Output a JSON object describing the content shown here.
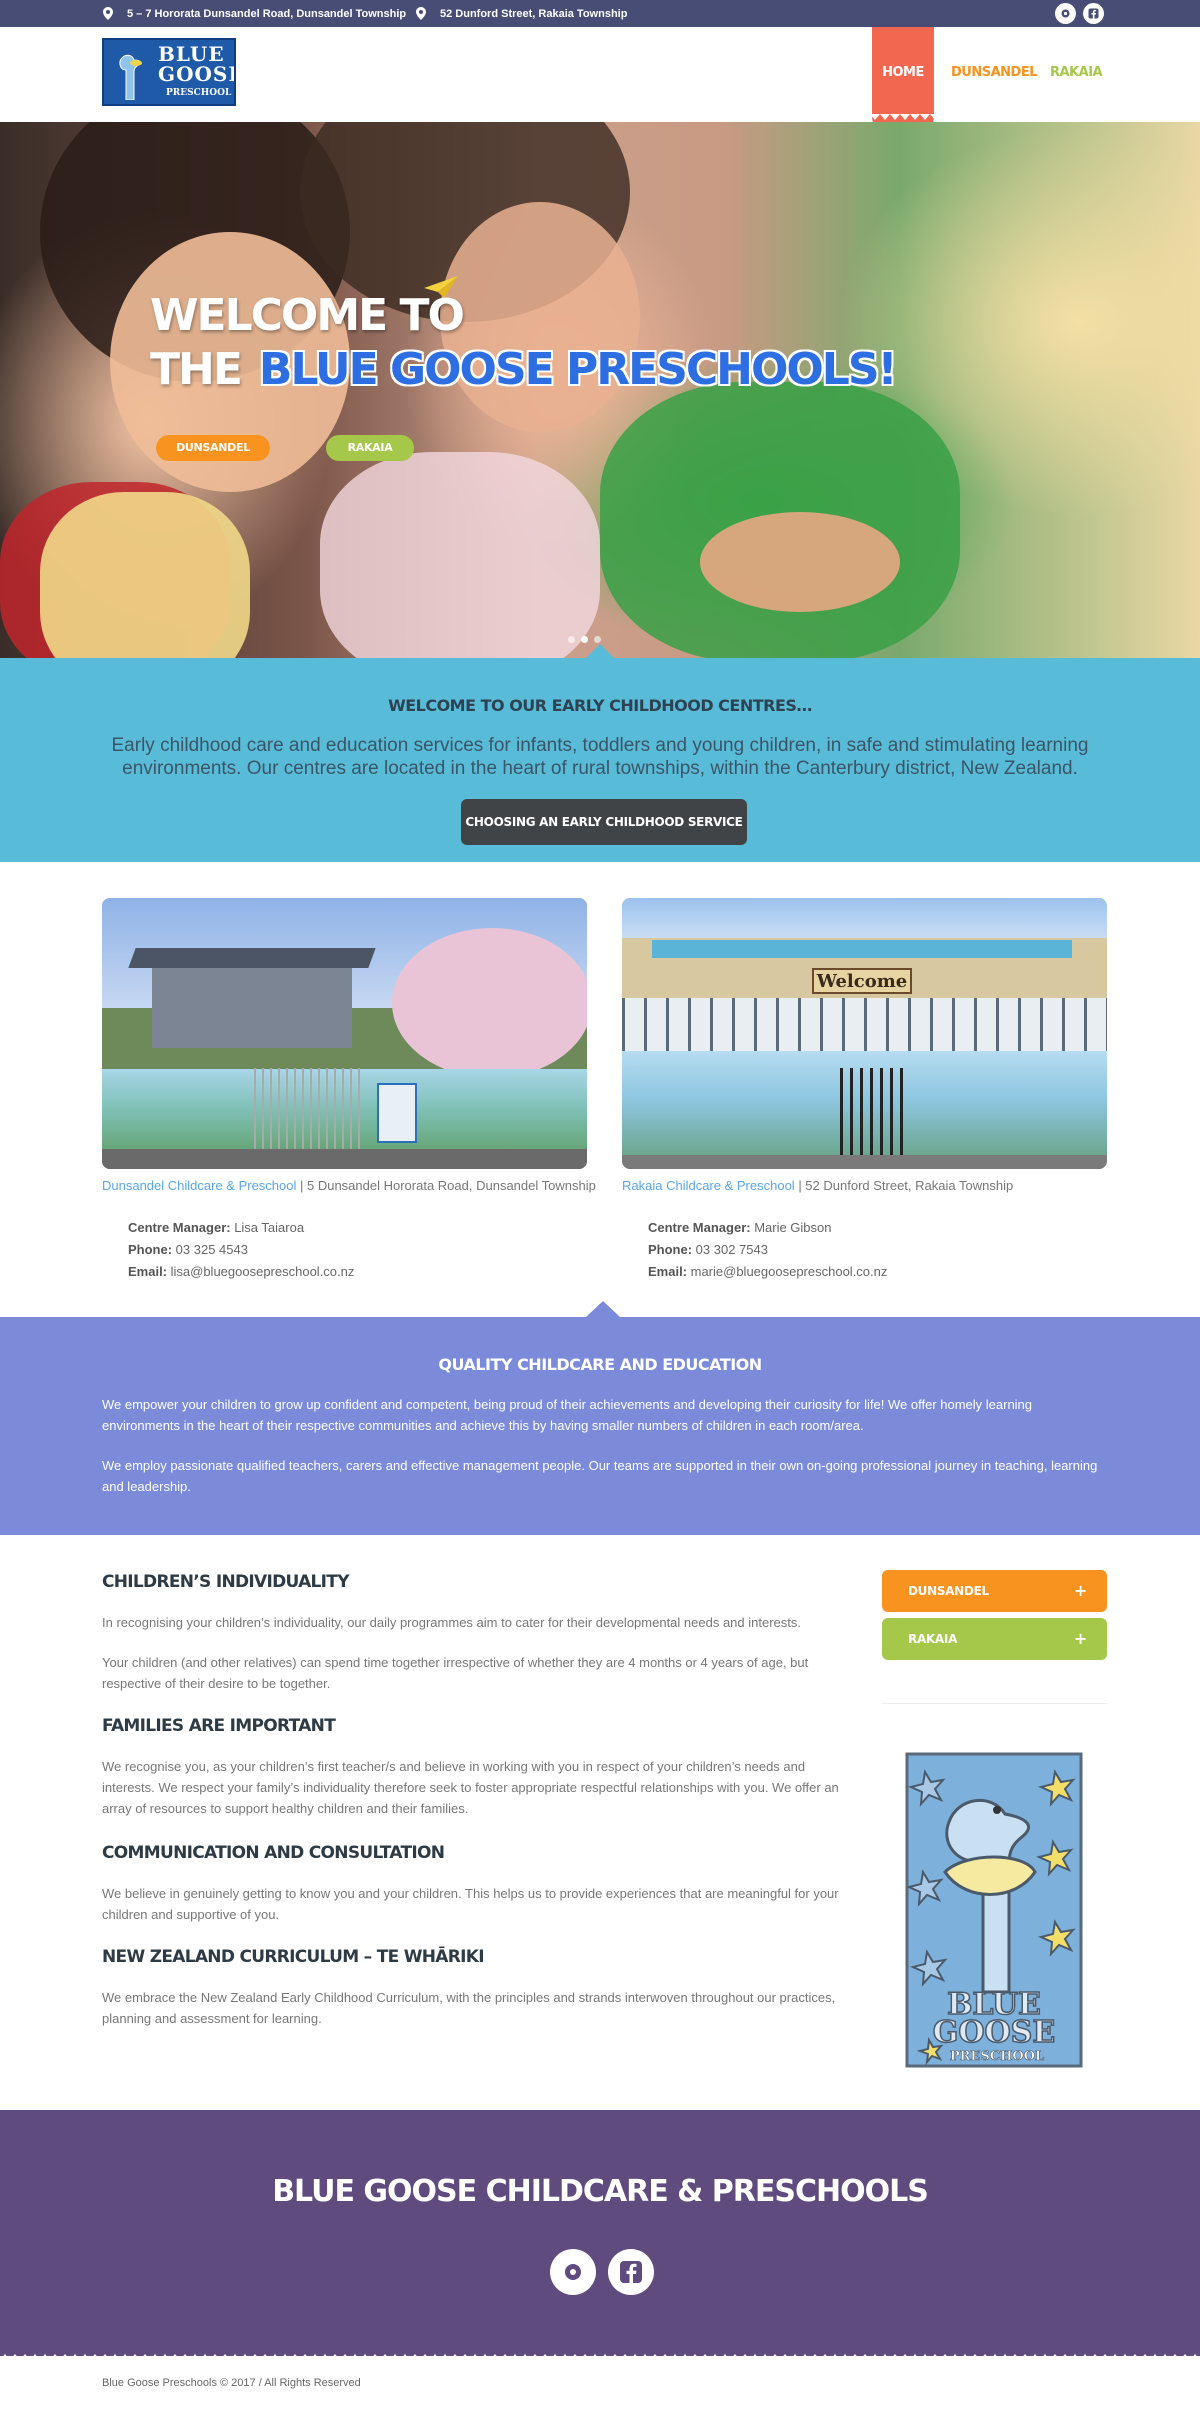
{
  "topbar": {
    "address1": "5 – 7 Hororata Dunsandel Road, Dunsandel Township",
    "address2": "52 Dunford Street, Rakaia Township",
    "social1_icon": "circle-icon",
    "social2_icon": "facebook-icon"
  },
  "logo": {
    "line1": "BLUE",
    "line2": "GOOSE",
    "line3": "PRESCHOOL"
  },
  "nav": {
    "home": "HOME",
    "dunsandel": "DUNSANDEL",
    "rakaia": "RAKAIA"
  },
  "hero": {
    "title_line1": "WELCOME TO",
    "title_the": "THE",
    "title_brand": "BLUE GOOSE PRESCHOOLS!",
    "btn_dunsandel": "DUNSANDEL",
    "btn_rakaia": "RAKAIA"
  },
  "welcome": {
    "heading": "WELCOME TO OUR EARLY CHILDHOOD CENTRES…",
    "text": "Early childhood care and education services for infants, toddlers and young children, in safe and stimulating learning environments. Our centres are located in the heart of rural townships, within the Canterbury district, New Zealand.",
    "button": "CHOOSING AN EARLY CHILDHOOD SERVICE"
  },
  "centres": [
    {
      "name": "Dunsandel Childcare & Preschool",
      "address": " | 5 Dunsandel Hororata Road, Dunsandel Township",
      "manager_label": "Centre Manager:",
      "manager": " Lisa Taiaroa",
      "phone_label": "Phone:",
      "phone": " 03 325 4543",
      "email_label": "Email:",
      "email": " lisa@bluegoosepreschool.co.nz"
    },
    {
      "name": "Rakaia Childcare & Preschool",
      "address": " | 52 Dunford Street, Rakaia Township",
      "manager_label": "Centre Manager:",
      "manager": " Marie Gibson",
      "phone_label": "Phone:",
      "phone": " 03 302 7543",
      "email_label": "Email:",
      "email": " marie@bluegoosepreschool.co.nz",
      "sign": "Welcome"
    }
  ],
  "quality": {
    "heading": "QUALITY CHILDCARE AND EDUCATION",
    "p1": "We empower your children to grow up confident and competent, being proud of their achievements and developing their curiosity for life! We offer homely learning environments in the heart of their respective communities and achieve this by having smaller numbers of children in each room/area.",
    "p2": "We employ passionate qualified teachers, carers and effective management people. Our teams are supported in their own on-going professional journey in teaching, learning and leadership."
  },
  "content": {
    "h1": "CHILDREN’S INDIVIDUALITY",
    "p1a": "In recognising your children’s individuality, our daily programmes aim to cater for their developmental needs and interests.",
    "p1b": "Your children (and other relatives) can spend time together irrespective of whether they are 4 months or 4 years of age, but respective of their desire to be together.",
    "h2": "FAMILIES ARE IMPORTANT",
    "p2": "We recognise you, as your children’s first teacher/s and believe in working with you in respect of your children’s needs and interests. We respect your family’s individuality therefore seek to foster appropriate respectful relationships with you. We offer an array of resources to support healthy children and their families.",
    "h3": "COMMUNICATION AND CONSULTATION",
    "p3": "We believe in genuinely getting to know you and your children. This helps us to provide experiences that are meaningful for your children and supportive of you.",
    "h4": "NEW ZEALAND CURRICULUM – TE WHĀRIKI",
    "p4": "We embrace the New Zealand Early Childhood Curriculum, with the principles and strands interwoven throughout our practices, planning and assessment for learning."
  },
  "sidebar": {
    "acc1": "DUNSANDEL",
    "acc2": "RAKAIA",
    "plus": "+",
    "badge_line1": "BLUE",
    "badge_line2": "GOOSE",
    "badge_line3": "PRESCHOOL"
  },
  "footer": {
    "heading": "BLUE GOOSE CHILDCARE & PRESCHOOLS",
    "social1_icon": "circle-icon",
    "social2_icon": "facebook-icon",
    "copyright": "Blue Goose Preschools © 2017 / All Rights Reserved"
  },
  "colors": {
    "topbar": "#474d74",
    "home_nav": "#f2674f",
    "orange": "#f7931e",
    "green": "#a6c84a",
    "welcome_bg": "#58bcd8",
    "quality_bg": "#7b8bda",
    "footer_bg": "#5f4b7e",
    "link": "#5aa6e6"
  }
}
